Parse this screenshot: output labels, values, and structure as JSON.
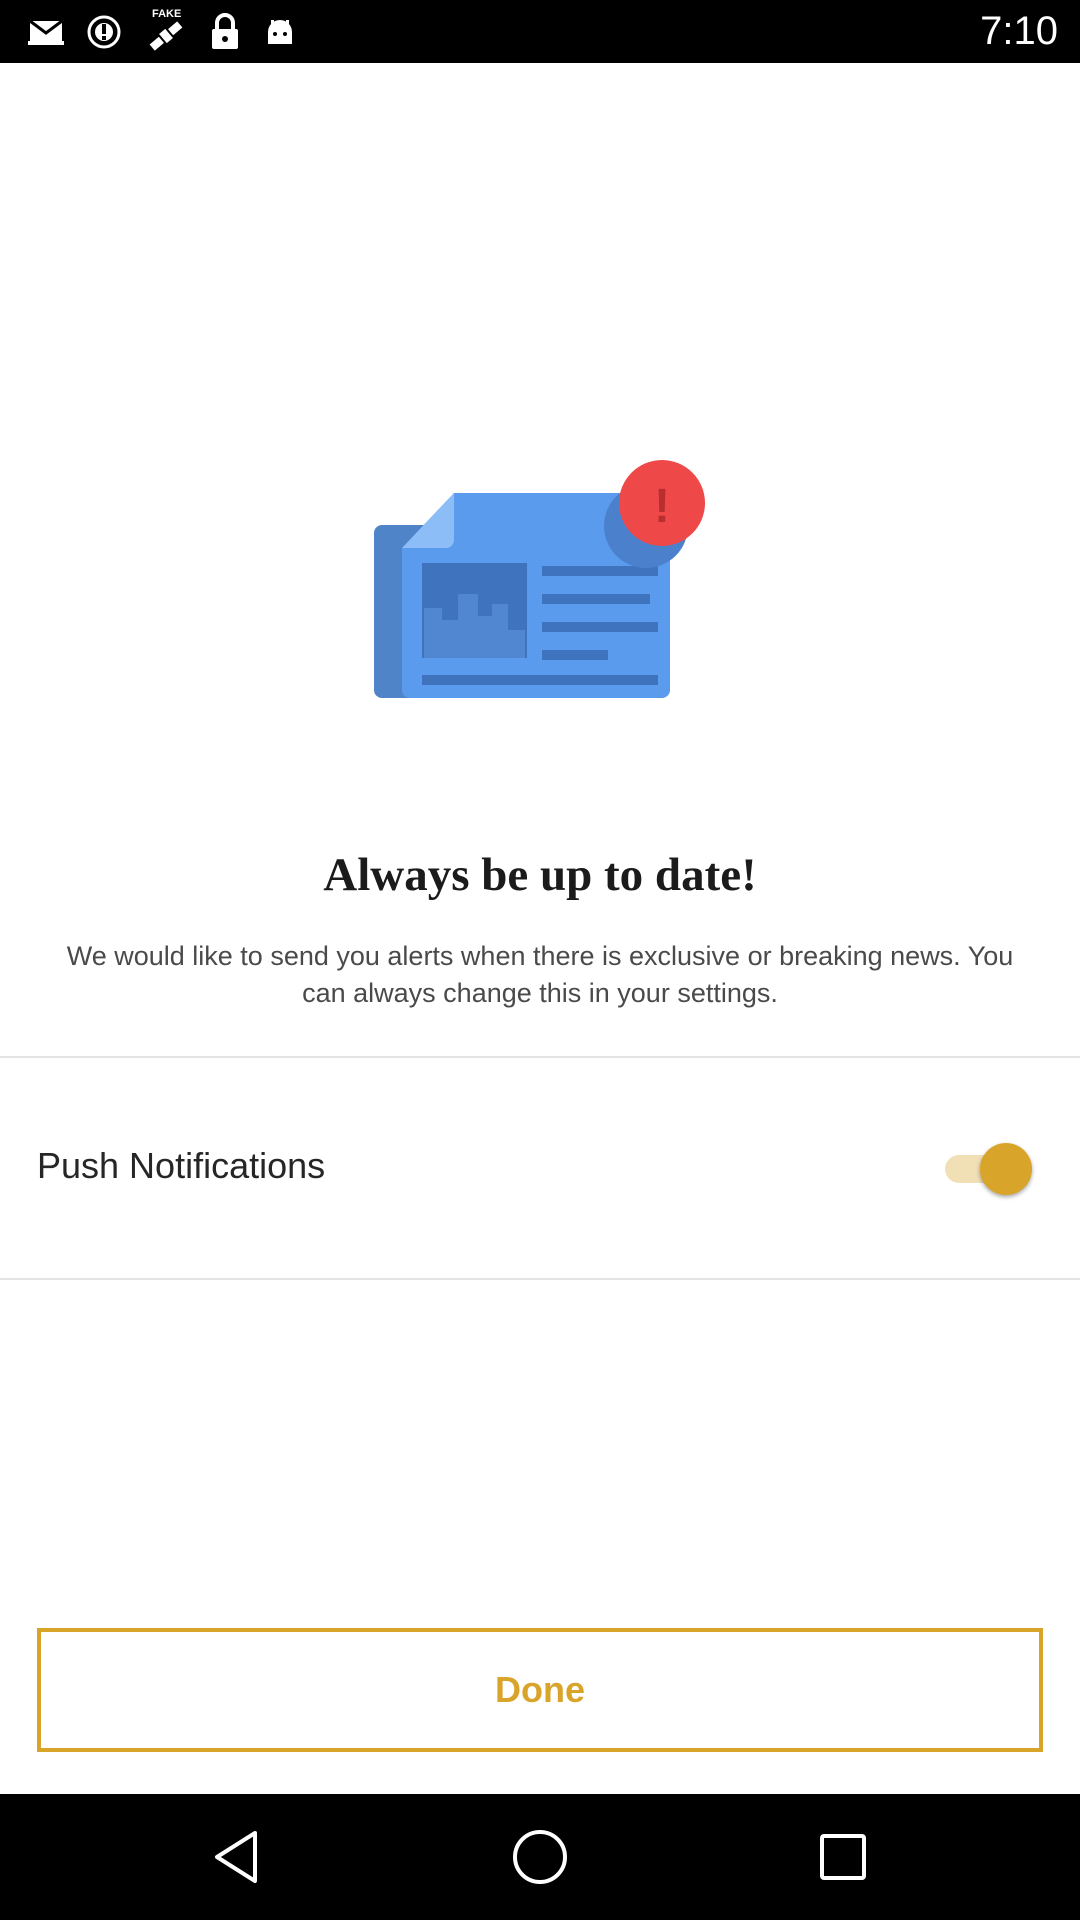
{
  "status_bar": {
    "time": "7:10",
    "icons": [
      "mail-icon",
      "alert-circle-icon",
      "fake-gps-satellite-icon",
      "lock-icon",
      "android-icon"
    ],
    "fake_label": "FAKE"
  },
  "hero": {
    "icon": "newspaper-alert-icon",
    "badge_symbol": "!",
    "colors": {
      "paper": "#5a9bee",
      "paper_dark": "#4f84c9",
      "image": "#3f73bd",
      "badge": "#ef4848"
    }
  },
  "onboarding": {
    "title": "Always be up to date!",
    "description": "We would like to send you alerts when there is exclusive or breaking news. You can always change this in your settings."
  },
  "settings": {
    "push_notifications_label": "Push Notifications",
    "push_notifications_enabled": true
  },
  "actions": {
    "done_label": "Done"
  },
  "theme": {
    "accent": "#d8a42a"
  },
  "nav_bar": {
    "buttons": [
      "back-icon",
      "home-icon",
      "recents-icon"
    ]
  }
}
